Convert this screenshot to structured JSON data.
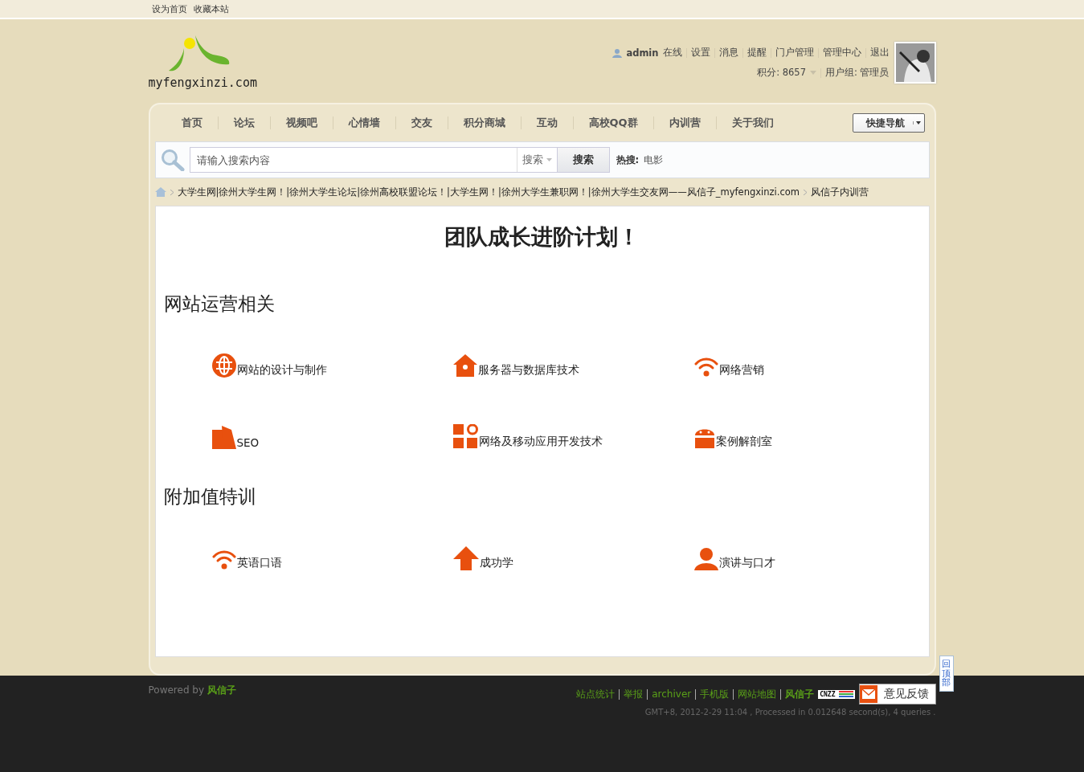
{
  "top_links": [
    "设为首页",
    "收藏本站"
  ],
  "logo_text": "myfengxinzi.com",
  "user": {
    "name": "admin",
    "status": "在线",
    "links": [
      "设置",
      "消息",
      "提醒",
      "门户管理",
      "管理中心",
      "退出"
    ],
    "points": "积分: 8657",
    "group": "用户组: 管理员"
  },
  "nav": [
    "首页",
    "论坛",
    "视频吧",
    "心情墙",
    "交友",
    "积分商城",
    "互动",
    "高校QQ群",
    "内训营",
    "关于我们"
  ],
  "quick_nav": "快捷导航",
  "search": {
    "placeholder": "请输入搜索内容",
    "type": "搜索",
    "button": "搜索",
    "hot_label": "热搜:",
    "hot": [
      "电影"
    ]
  },
  "breadcrumb": [
    "大学生网|徐州大学生网！|徐州大学生论坛|徐州高校联盟论坛！|大学生网！|徐州大学生兼职网！|徐州大学生交友网——风信子_myfengxinzi.com",
    "风信子内训营"
  ],
  "title": "团队成长进阶计划！",
  "sections": [
    {
      "heading": "网站运营相关",
      "items": [
        "网站的设计与制作",
        "服务器与数据库技术",
        "网络营销",
        "SEO",
        "网络及移动应用开发技术",
        "案例解剖室"
      ]
    },
    {
      "heading": "附加值特训",
      "items": [
        "英语口语",
        "成功学",
        "演讲与口才"
      ]
    }
  ],
  "back_to_top": "回顶部",
  "footer": {
    "powered": "Powered by",
    "brand": "风信子",
    "links": [
      "站点统计",
      "举报",
      "archiver",
      "手机版",
      "网站地图",
      "风信子"
    ],
    "cnzz": "CNZZ",
    "feedback": "意见反馈",
    "stats": "GMT+8, 2012-2-29 11:04 , Processed in 0.012648 second(s), 4 queries ."
  }
}
